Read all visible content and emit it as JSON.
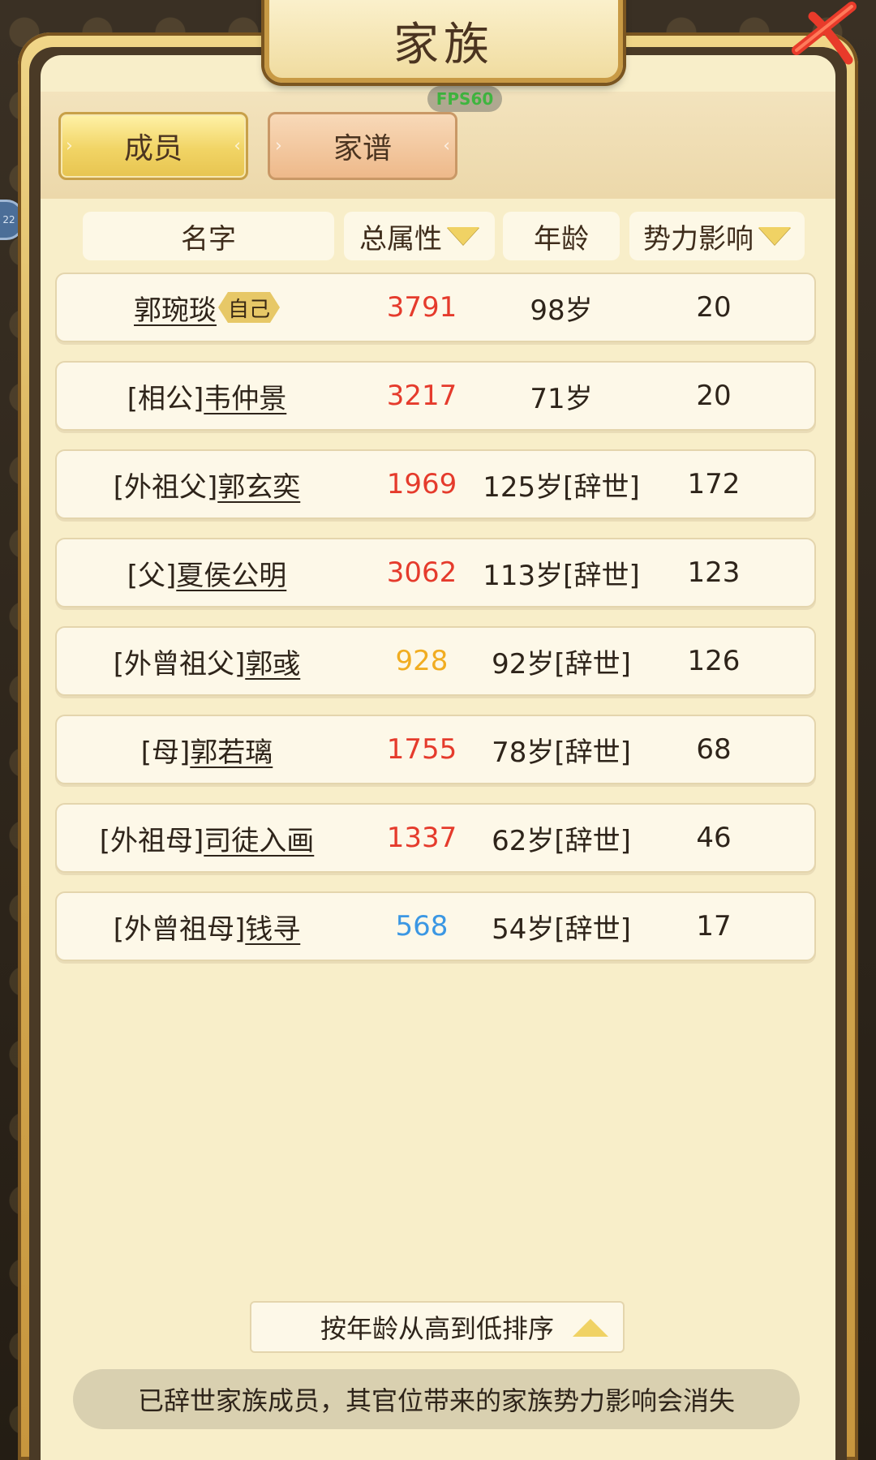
{
  "window": {
    "title": "家族"
  },
  "fps": "FPS60",
  "side_badge": "22",
  "tabs": [
    {
      "label": "成员",
      "active": true
    },
    {
      "label": "家谱",
      "active": false
    }
  ],
  "columns": {
    "name": "名字",
    "attr": "总属性",
    "age": "年龄",
    "influence": "势力影响"
  },
  "self_badge": "自己",
  "members": [
    {
      "prefix": "",
      "name": "郭琬琰",
      "attr": "3791",
      "attr_color": "#e53b2c",
      "age": "98岁",
      "influence": "20"
    },
    {
      "prefix": "[相公]",
      "name": "韦仲景",
      "attr": "3217",
      "attr_color": "#e53b2c",
      "age": "71岁",
      "influence": "20"
    },
    {
      "prefix": "[外祖父]",
      "name": "郭玄奕",
      "attr": "1969",
      "attr_color": "#e53b2c",
      "age": "125岁[辞世]",
      "influence": "172"
    },
    {
      "prefix": "[父]",
      "name": "夏侯公明",
      "attr": "3062",
      "attr_color": "#e53b2c",
      "age": "113岁[辞世]",
      "influence": "123"
    },
    {
      "prefix": "[外曾祖父]",
      "name": "郭彧",
      "attr": "928",
      "attr_color": "#f1ad21",
      "age": "92岁[辞世]",
      "influence": "126"
    },
    {
      "prefix": "[母]",
      "name": "郭若璃",
      "attr": "1755",
      "attr_color": "#e53b2c",
      "age": "78岁[辞世]",
      "influence": "68"
    },
    {
      "prefix": "[外祖母]",
      "name": "司徒入画",
      "attr": "1337",
      "attr_color": "#e53b2c",
      "age": "62岁[辞世]",
      "influence": "46"
    },
    {
      "prefix": "[外曾祖母]",
      "name": "钱寻",
      "attr": "568",
      "attr_color": "#3b97e3",
      "age": "54岁[辞世]",
      "influence": "17"
    }
  ],
  "sort_button": "按年龄从高到低排序",
  "notice": "已辞世家族成员，其官位带来的家族势力影响会消失",
  "icons": {
    "close": "close-x-icon",
    "sort_desc": "triangle-down-icon",
    "sort_asc": "triangle-up-icon"
  }
}
